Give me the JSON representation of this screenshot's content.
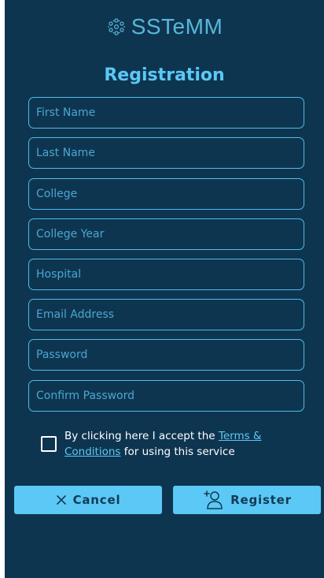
{
  "brand": {
    "name": "SSTeMM",
    "logo_icon": "molecule-logo-icon"
  },
  "title": "Registration",
  "fields": {
    "first_name": "First Name",
    "last_name": "Last Name",
    "college": "College",
    "college_year": "College Year",
    "hospital": "Hospital",
    "email": "Email Address",
    "password": "Password",
    "confirm_password": "Confirm Password"
  },
  "terms": {
    "prefix": "By clicking here I accept the ",
    "link": "Terms & Conditions",
    "suffix": " for using this service"
  },
  "buttons": {
    "cancel": "Cancel",
    "cancel_icon": "close-icon",
    "register": "Register",
    "register_icon": "add-user-icon"
  },
  "colors": {
    "background": "#0e3550",
    "accent": "#5cc8f5",
    "button_text": "#123a55"
  }
}
